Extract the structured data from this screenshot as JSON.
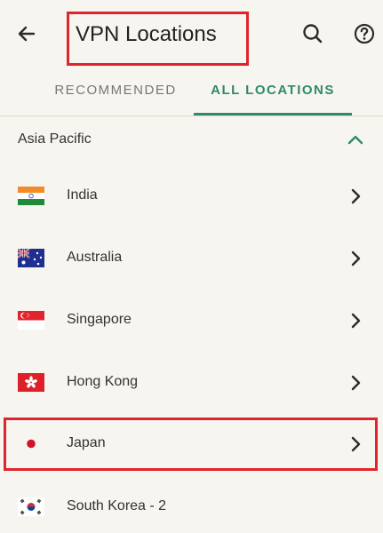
{
  "header": {
    "title": "VPN Locations"
  },
  "tabs": [
    {
      "label": "RECOMMENDED",
      "selected": false
    },
    {
      "label": "ALL LOCATIONS",
      "selected": true
    }
  ],
  "section": {
    "title": "Asia Pacific",
    "expanded": true
  },
  "locations": [
    {
      "name": "India",
      "flag": "india-flag-icon"
    },
    {
      "name": "Australia",
      "flag": "australia-flag-icon"
    },
    {
      "name": "Singapore",
      "flag": "singapore-flag-icon"
    },
    {
      "name": "Hong Kong",
      "flag": "hong-kong-flag-icon"
    },
    {
      "name": "Japan",
      "flag": "japan-flag-icon",
      "highlighted": true
    },
    {
      "name": "South Korea - 2",
      "flag": "south-korea-flag-icon"
    }
  ],
  "colors": {
    "accent": "#2f8a6b",
    "highlight": "#e0242c",
    "background": "#f7f5ef"
  },
  "icons": {
    "back": "arrow-left-icon",
    "search": "search-icon",
    "help": "help-circle-icon",
    "collapse": "chevron-up-icon",
    "row": "chevron-right-icon"
  }
}
